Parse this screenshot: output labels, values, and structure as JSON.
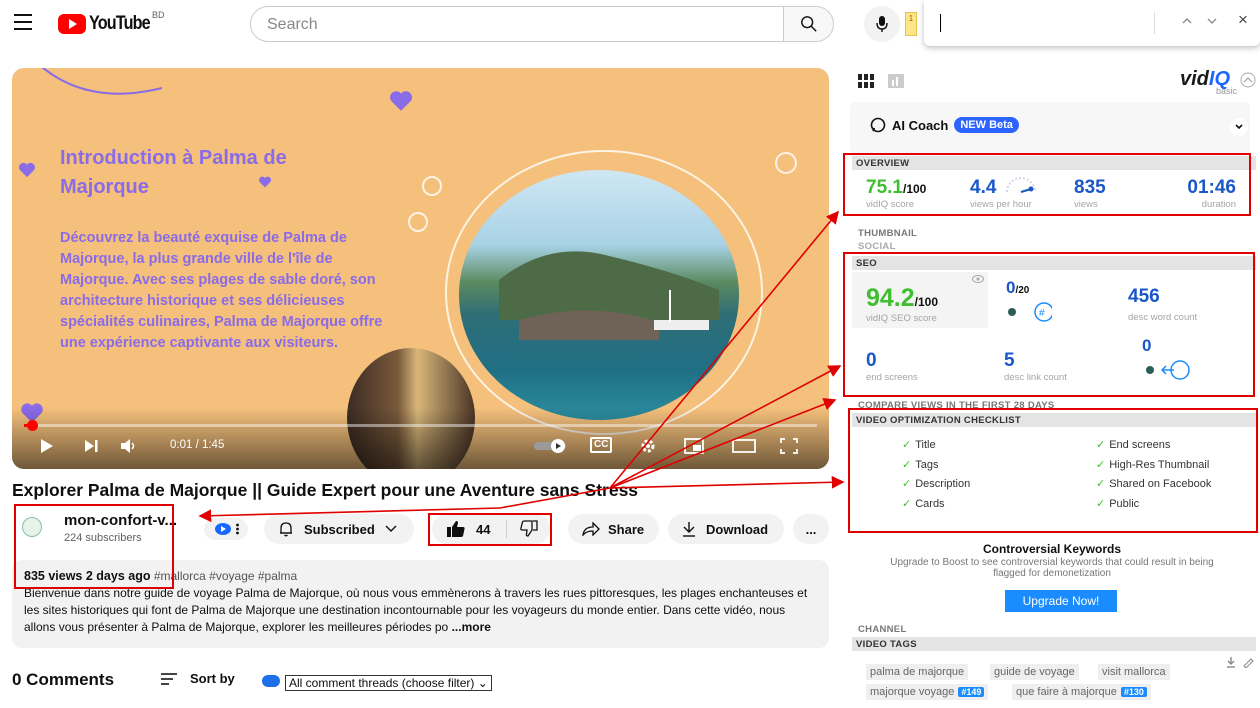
{
  "topbar": {
    "logo_text": "YouTube",
    "country_code": "BD",
    "search_placeholder": "Search",
    "ext_badge": "1"
  },
  "find_bar": {
    "up_label": "^",
    "down_label": "v",
    "close_label": "×"
  },
  "video": {
    "slide_title": "Introduction à Palma de Majorque",
    "slide_text": "Découvrez la beauté exquise de Palma de Majorque, la plus grande ville de l'île de Majorque. Avec ses plages de sable doré, son architecture historique et ses délicieuses spécialités culinaires, Palma de Majorque offre une expérience captivante aux visiteurs.",
    "time_display": "0:01 / 1:45",
    "progress_fraction": 0.01,
    "cc_label": "CC"
  },
  "details": {
    "title": "Explorer Palma de Majorque || Guide Expert pour une Aventure sans Stress",
    "channel_name": "mon-confort-v...",
    "subscribers": "224 subscribers",
    "subscribed_label": "Subscribed",
    "like_count": "44",
    "share_label": "Share",
    "download_label": "Download",
    "more_label": "..."
  },
  "description": {
    "meta": "835 views  2 days ago",
    "tags": "#mallorca #voyage #palma",
    "body": "Bienvenue dans notre guide de voyage Palma de Majorque, où nous vous emmènerons à travers les rues pittoresques, les plages enchanteuses et les sites historiques qui font de Palma de Majorque une destination incontournable pour les voyageurs du monde entier. Dans cette vidéo, nous allons vous présenter à Palma de Majorque, explorer les meilleures périodes po",
    "more": "...more"
  },
  "comments": {
    "count_label": "0 Comments",
    "sort_label": "Sort by",
    "filter_label": "All comment threads (choose filter) ⌄"
  },
  "vidiq": {
    "logo_main": "vid",
    "logo_accent": "IQ",
    "plan": "basic",
    "ai_coach_label": "AI Coach",
    "beta_label": "NEW Beta",
    "overview": {
      "heading": "OVERVIEW",
      "score": "75.1",
      "score_unit": "/100",
      "score_label": "vidIQ score",
      "vph": "4.4",
      "vph_label": "views per hour",
      "views": "835",
      "views_label": "views",
      "duration": "01:46",
      "duration_label": "duration"
    },
    "thumbnail_label": "THUMBNAIL",
    "social_label": "SOCIAL",
    "seo": {
      "heading": "SEO",
      "score": "94.2",
      "score_unit": "/100",
      "score_label": "vidIQ SEO score",
      "keywords": "0",
      "keywords_unit": "/20",
      "desc_words": "456",
      "desc_words_label": "desc word count",
      "end_screens": "0",
      "end_screens_label": "end screens",
      "desc_links": "5",
      "desc_links_label": "desc link count",
      "cards": "0"
    },
    "compare_label": "COMPARE VIEWS IN THE FIRST 28 DAYS",
    "checklist": {
      "heading": "VIDEO OPTIMIZATION CHECKLIST",
      "left": [
        "Title",
        "Tags",
        "Description",
        "Cards"
      ],
      "right": [
        "End screens",
        "High-Res Thumbnail",
        "Shared on Facebook",
        "Public"
      ]
    },
    "controversial": {
      "title": "Controversial Keywords",
      "text": "Upgrade to Boost to see controversial keywords that could result in being flagged for demonetization",
      "button": "Upgrade Now!"
    },
    "channel_label": "CHANNEL",
    "tags_heading": "VIDEO TAGS",
    "tags": [
      {
        "text": "palma de majorque",
        "rank": ""
      },
      {
        "text": "guide de voyage",
        "rank": ""
      },
      {
        "text": "visit mallorca",
        "rank": ""
      },
      {
        "text": "majorque voyage",
        "rank": "#149"
      },
      {
        "text": "que faire à majorque",
        "rank": "#130"
      }
    ]
  },
  "colors": {
    "accent_red": "#e00000",
    "vidiq_blue": "#1a8cff",
    "score_green": "#3fbf2f",
    "slide_bg": "#f4c07c",
    "slide_text": "#8a6be8"
  }
}
